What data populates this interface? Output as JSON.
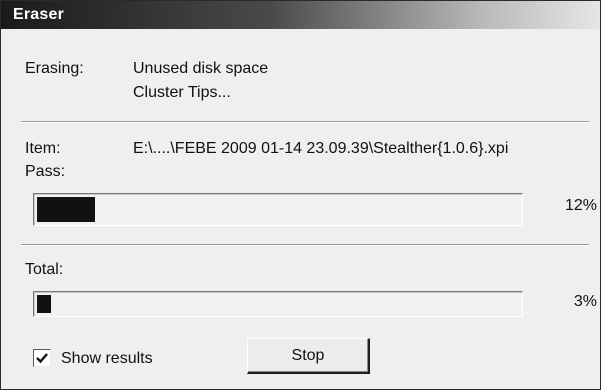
{
  "window": {
    "title": "Eraser"
  },
  "status": {
    "erasing_label": "Erasing:",
    "erasing_value_line1": "Unused disk space",
    "erasing_value_line2": "Cluster Tips...",
    "item_label": "Item:",
    "item_value": "E:\\....\\FEBE 2009 01-14 23.09.39\\Stealther{1.0.6}.xpi",
    "pass_label": "Pass:"
  },
  "pass_progress": {
    "percent_text": "12%",
    "fraction": 0.12
  },
  "total_progress": {
    "label": "Total:",
    "percent_text": "3%",
    "fraction": 0.03
  },
  "options": {
    "show_results_label": "Show results",
    "show_results_checked": true
  },
  "buttons": {
    "stop_label": "Stop"
  },
  "colors": {
    "progress_fill": "#111111",
    "title_text": "#ffffff"
  }
}
